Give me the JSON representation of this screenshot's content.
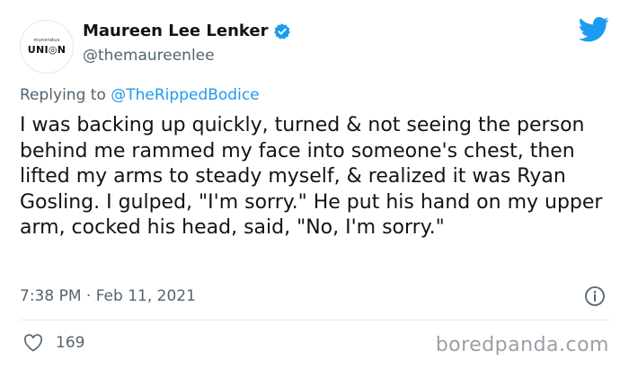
{
  "author": {
    "avatar_small_text": "muneratus",
    "avatar_logo_text": "UNI◎N",
    "display_name": "Maureen Lee Lenker",
    "handle": "@themaureenlee",
    "verified": true
  },
  "reply": {
    "prefix": "Replying to ",
    "mention": "@TheRippedBodice"
  },
  "tweet": {
    "text": "I was backing up quickly, turned & not seeing the person behind me rammed my face into someone's chest, then lifted my arms to steady myself, & realized it was Ryan Gosling. I gulped, \"I'm sorry.\" He put his hand on my upper arm, cocked his head, said, \"No, I'm sorry.\"",
    "timestamp": "7:38 PM · Feb 11, 2021",
    "likes": "169"
  },
  "watermark": "boredpanda.com",
  "colors": {
    "twitter_blue": "#1d9bf0",
    "secondary_text": "#536471"
  },
  "icons": {
    "verified": "verified-badge-icon",
    "brand": "twitter-bird-icon",
    "info": "info-icon",
    "like": "heart-icon"
  }
}
